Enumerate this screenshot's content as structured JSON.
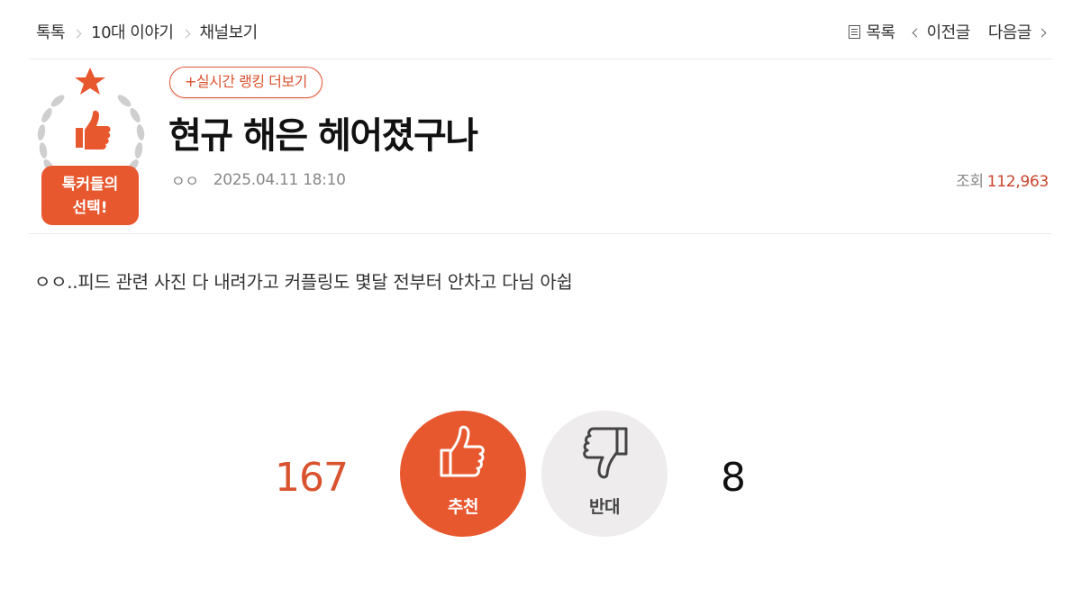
{
  "breadcrumb": [
    "톡톡",
    "10대 이야기",
    "채널보기"
  ],
  "nav": {
    "list": "목록",
    "prev": "이전글",
    "next": "다음글"
  },
  "badge": {
    "line1": "톡커들의",
    "line2": "선택!"
  },
  "post": {
    "ranking_button": "+실시간 랭킹 더보기",
    "title": "현규 해은 헤어졌구나",
    "author": "ㅇㅇ",
    "datetime": "2025.04.11 18:10",
    "views_label": "조회",
    "views": "112,963",
    "body": "ㅇㅇ..피드 관련 사진 다 내려가고 커플링도 몇달 전부터 안차고 다님 아쉽"
  },
  "votes": {
    "up_label": "추천",
    "up_count": "167",
    "down_label": "반대",
    "down_count": "8"
  },
  "colors": {
    "accent": "#e8582f",
    "views_number": "#c9432a"
  }
}
